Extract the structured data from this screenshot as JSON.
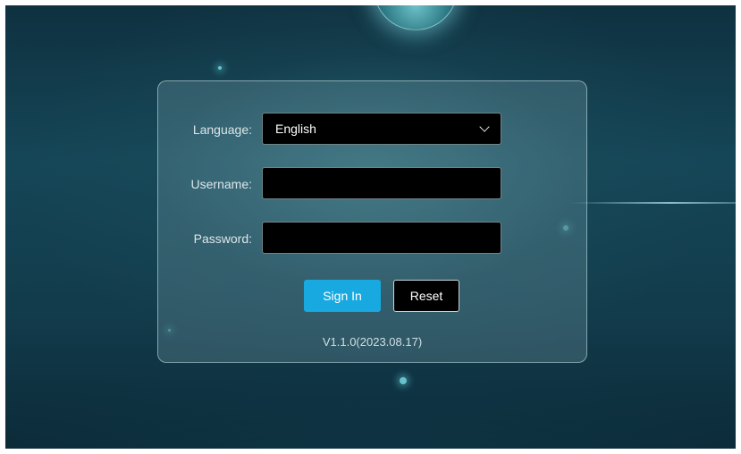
{
  "login": {
    "language_label": "Language:",
    "language_value": "English",
    "username_label": "Username:",
    "username_value": "",
    "password_label": "Password:",
    "password_value": "",
    "signin_label": "Sign In",
    "reset_label": "Reset",
    "version": "V1.1.0(2023.08.17)"
  },
  "icons": {
    "language_dropdown": "chevron-down-icon"
  },
  "colors": {
    "background": "#134455",
    "signin_button": "#18a9e0",
    "field_background": "#000000"
  }
}
